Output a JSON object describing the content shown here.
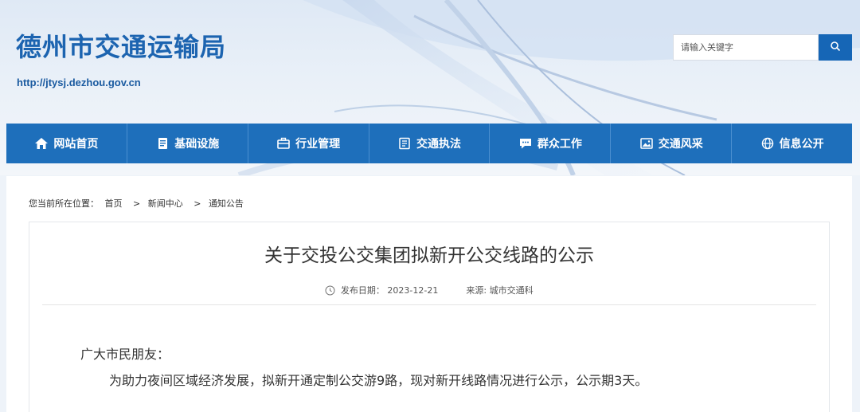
{
  "header": {
    "site_title": "德州市交通运输局",
    "site_url": "http://jtysj.dezhou.gov.cn",
    "search_placeholder": "请输入关键字",
    "search_button_icon": "search-icon"
  },
  "nav": {
    "items": [
      {
        "label": "网站首页",
        "icon": "home-icon"
      },
      {
        "label": "基础设施",
        "icon": "document-icon"
      },
      {
        "label": "行业管理",
        "icon": "briefcase-icon"
      },
      {
        "label": "交通执法",
        "icon": "book-icon"
      },
      {
        "label": "群众工作",
        "icon": "chat-icon"
      },
      {
        "label": "交通风采",
        "icon": "image-icon"
      },
      {
        "label": "信息公开",
        "icon": "globe-icon"
      }
    ]
  },
  "breadcrumb": {
    "prefix": "您当前所在位置：",
    "items": [
      "首页",
      "新闻中心",
      "通知公告"
    ],
    "separator": ">"
  },
  "article": {
    "title": "关于交投公交集团拟新开公交线路的公示",
    "date_label": "发布日期：",
    "date": "2023-12-21",
    "source_label": "来源:",
    "source": "城市交通科",
    "salutation": "广大市民朋友：",
    "paragraph": "为助力夜间区域经济发展，拟新开通定制公交游9路，现对新开线路情况进行公示，公示期3天。"
  },
  "colors": {
    "brand_blue": "#1e6fbb",
    "title_blue": "#1c64b0"
  }
}
